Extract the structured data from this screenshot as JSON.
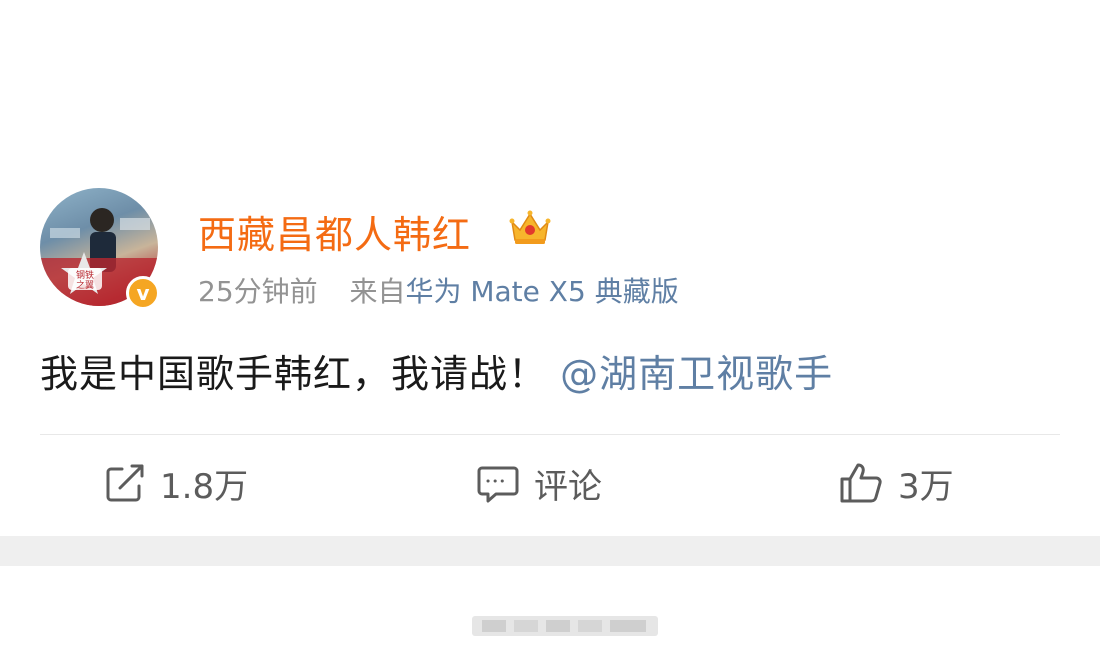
{
  "post": {
    "username": "西藏昌都人韩红",
    "time": "25分钟前",
    "source_prefix": "来自",
    "source_device": "华为 Mate X5 典藏版",
    "text": "我是中国歌手韩红，我请战！",
    "mention": "@湖南卫视歌手",
    "verified_mark": "v"
  },
  "actions": {
    "repost_count": "1.8万",
    "comment_label": "评论",
    "like_count": "3万"
  },
  "icons": {
    "repost": "repost-icon",
    "comment": "comment-icon",
    "like": "like-icon",
    "crown": "crown-icon",
    "verified": "verified-badge-icon"
  },
  "colors": {
    "username": "#f46b13",
    "link": "#5f7fa4",
    "meta": "#939393",
    "verified": "#f5a623"
  }
}
